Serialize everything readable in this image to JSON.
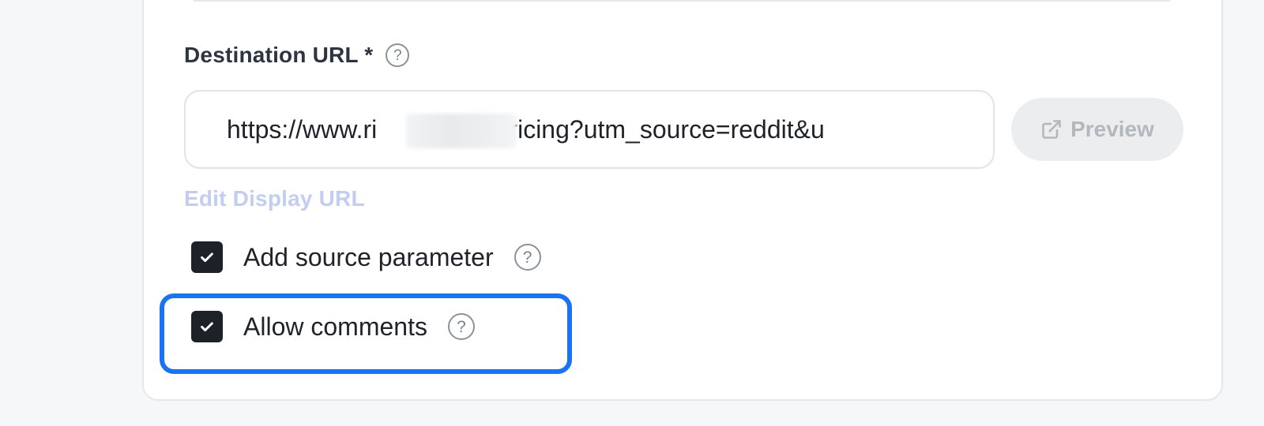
{
  "destination": {
    "label": "Destination URL *",
    "help_icon": "question-circle-icon",
    "url_value": "https://www.ri        .com/pricing?utm_source=reddit&u",
    "preview_label": "Preview",
    "preview_icon": "external-link-icon"
  },
  "edit_display_url": "Edit Display URL",
  "options": [
    {
      "label": "Add source parameter",
      "checked": true,
      "help_icon": "question-circle-icon"
    },
    {
      "label": "Allow comments",
      "checked": true,
      "help_icon": "question-circle-icon"
    }
  ],
  "colors": {
    "highlight": "#1a73f0",
    "checkbox": "#1d2228",
    "link_disabled": "#c2cdf0",
    "button_disabled_bg": "#ebedef"
  }
}
